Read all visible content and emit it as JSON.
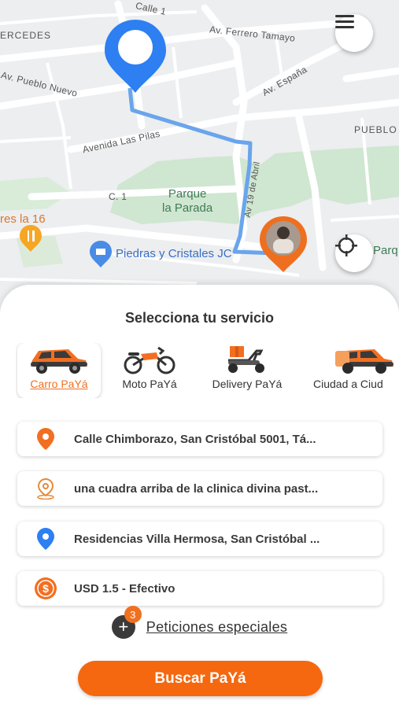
{
  "map": {
    "streets": {
      "calle1": "Calle 1",
      "mercedes": "ERCEDES",
      "ferrero": "Av. Ferrero Tamayo",
      "pueblo_nuevo": "Av. Pueblo Nuevo",
      "espana": "Av. España",
      "pueblo": "PUEBLO",
      "las_pilas": "Avenida Las Pilas",
      "abril": "Av 19 de Abril",
      "c1": "C. 1"
    },
    "park": "Parque\nla Parada",
    "poi_store": "Piedras y Cristales JC",
    "poi_food": "res la 16",
    "poi_right": "Parq",
    "menu_button": "menu-icon",
    "locate_button": "crosshair-icon"
  },
  "sheet": {
    "title": "Selecciona tu servicio",
    "services": [
      {
        "label": "Carro PaYá",
        "icon": "car-icon",
        "selected": true
      },
      {
        "label": "Moto PaYá",
        "icon": "motorcycle-icon",
        "selected": false
      },
      {
        "label": "Delivery PaYá",
        "icon": "delivery-scooter-icon",
        "selected": false
      },
      {
        "label": "Ciudad a Ciud",
        "icon": "car-luggage-icon",
        "selected": false
      }
    ],
    "fields": [
      {
        "text": "Calle Chimborazo, San Cristóbal 5001, Tá...",
        "icon": "origin-pin-icon"
      },
      {
        "text": "una cuadra arriba de la clinica divina past...",
        "icon": "reference-pin-icon"
      },
      {
        "text": "Residencias Villa Hermosa, San Cristóbal ...",
        "icon": "destination-pin-icon"
      },
      {
        "text": "USD 1.5 - Efectivo",
        "icon": "dollar-coin-icon"
      }
    ],
    "special_requests": {
      "label": "Peticiones especiales",
      "count": "3"
    },
    "cta": "Buscar PaYá"
  },
  "colors": {
    "accent": "#f5680f",
    "route": "#6aa5ec",
    "pin_blue": "#2d7ff2",
    "park_green": "#cde7cf"
  }
}
